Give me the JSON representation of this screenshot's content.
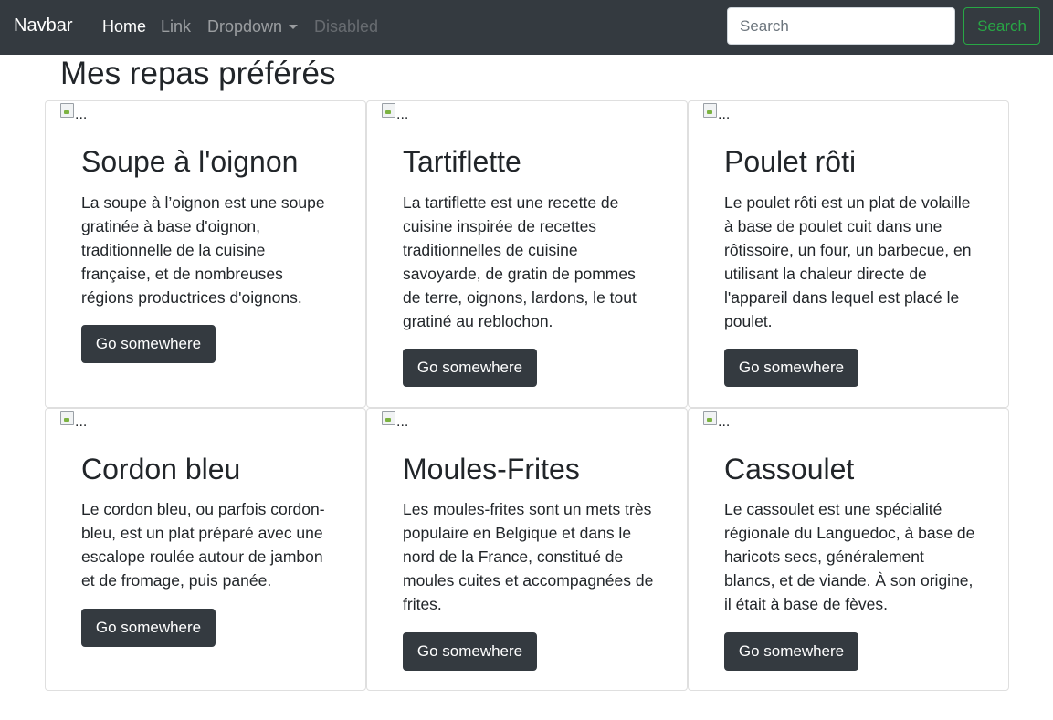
{
  "navbar": {
    "brand": "Navbar",
    "links": [
      {
        "label": "Home",
        "state": "active"
      },
      {
        "label": "Link",
        "state": "normal"
      },
      {
        "label": "Dropdown",
        "state": "normal"
      },
      {
        "label": "Disabled",
        "state": "disabled"
      }
    ],
    "search_placeholder": "Search",
    "search_button": "Search"
  },
  "page_title": "Mes repas préférés",
  "cards": [
    {
      "img_alt": "...",
      "title": "Soupe à l'oignon",
      "text": "La soupe à l’oignon est une soupe gratinée à base d'oignon, traditionnelle de la cuisine française, et de nombreuses régions productrices d'oignons.",
      "button": "Go somewhere"
    },
    {
      "img_alt": "...",
      "title": "Tartiflette",
      "text": "La tartiflette est une recette de cuisine inspirée de recettes traditionnelles de cuisine savoyarde, de gratin de pommes de terre, oignons, lardons, le tout gratiné au reblochon.",
      "button": "Go somewhere"
    },
    {
      "img_alt": "...",
      "title": "Poulet rôti",
      "text": "Le poulet rôti est un plat de volaille à base de poulet cuit dans une rôtissoire, un four, un barbecue, en utilisant la chaleur directe de l'appareil dans lequel est placé le poulet.",
      "button": "Go somewhere"
    },
    {
      "img_alt": "...",
      "title": "Cordon bleu",
      "text": "Le cordon bleu, ou parfois cordon-bleu, est un plat préparé avec une escalope roulée autour de jambon et de fromage, puis panée.",
      "button": "Go somewhere"
    },
    {
      "img_alt": "...",
      "title": "Moules-Frites",
      "text": "Les moules-frites sont un mets très populaire en Belgique et dans le nord de la France, constitué de moules cuites et accompagnées de frites.",
      "button": "Go somewhere"
    },
    {
      "img_alt": "...",
      "title": "Cassoulet",
      "text": "Le cassoulet est une spécialité régionale du Languedoc, à base de haricots secs, généralement blancs, et de viande. À son origine, il était à base de fèves.",
      "button": "Go somewhere"
    }
  ],
  "colors": {
    "navbar_bg": "#343a40",
    "success": "#28a745",
    "button_dark": "#343a40"
  }
}
